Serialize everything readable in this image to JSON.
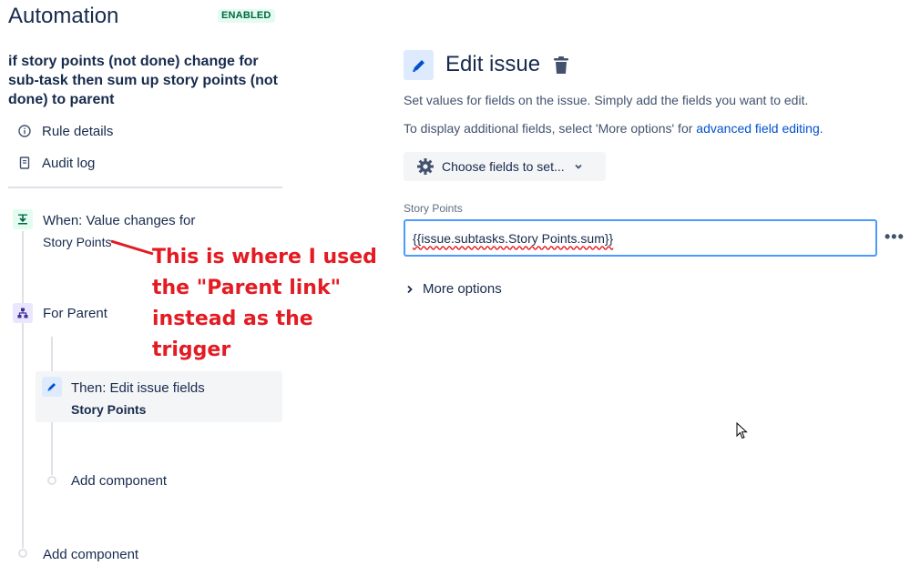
{
  "header": {
    "title": "Automation",
    "status_badge": "ENABLED"
  },
  "rule": {
    "name": "if story points (not done) change for sub-task then sum up story points (not done) to parent"
  },
  "nav": {
    "rule_details": "Rule details",
    "audit_log": "Audit log"
  },
  "flow": {
    "trigger_label": "When: Value changes for",
    "trigger_field": "Story Points",
    "branch_label": "For Parent",
    "action_label": "Then: Edit issue fields",
    "action_field": "Story Points",
    "add_component_inner": "Add component",
    "add_component_outer": "Add component"
  },
  "annotation": {
    "line1": "This is where I used",
    "line2": "the \"Parent link\"",
    "line3": "instead as the trigger",
    "color": "#e31b23"
  },
  "detail": {
    "title": "Edit issue",
    "desc1": "Set values for fields on the issue. Simply add the fields you want to edit.",
    "desc2_prefix": "To display additional fields, select 'More options' for ",
    "desc2_link": "advanced field editing",
    "desc2_suffix": ".",
    "choose_fields": "Choose fields to set...",
    "field_label": "Story Points",
    "field_value": "{{issue.subtasks.Story Points.sum}}",
    "more_menu": "•••",
    "more_options": "More options"
  },
  "icons": {
    "info": "info-icon",
    "audit": "document-icon",
    "trigger": "trigger-icon",
    "branch": "branch-icon",
    "edit": "pencil-icon",
    "trash": "trash-icon",
    "gear": "gear-icon",
    "chevron_down": "chevron-down-icon",
    "chevron_right": "chevron-right-icon"
  }
}
